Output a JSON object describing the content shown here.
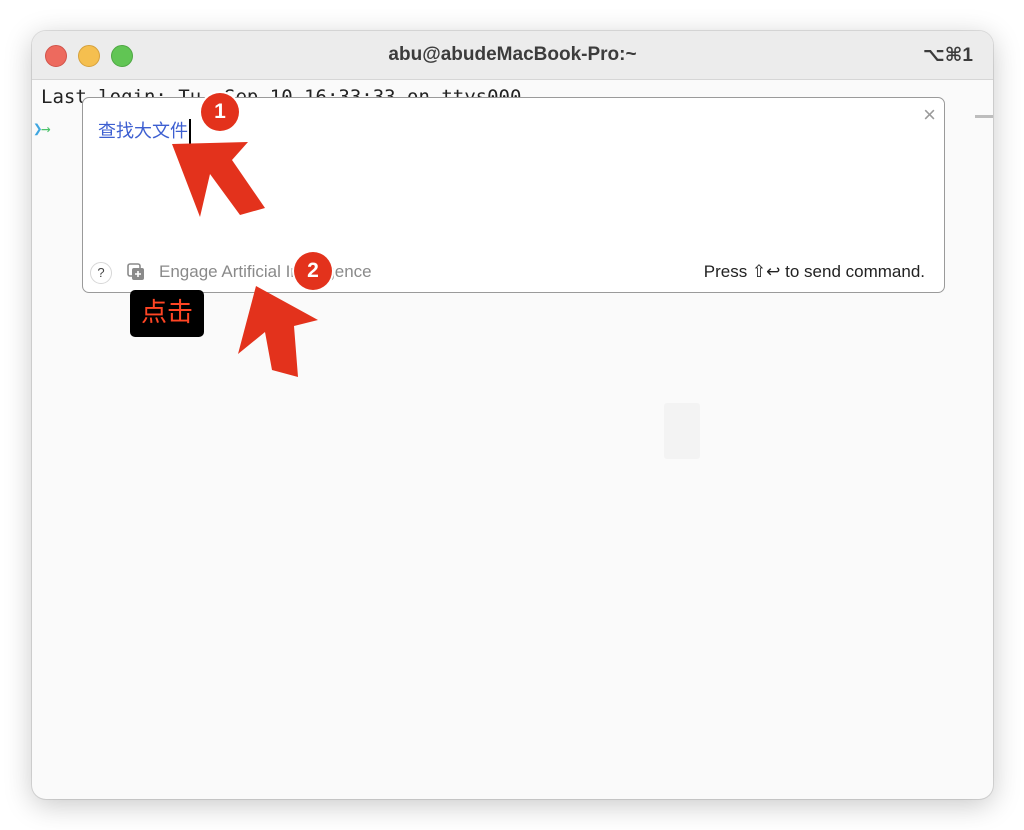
{
  "window": {
    "title": "abu@abudeMacBook-Pro:~",
    "shortcut": "⌥⌘1"
  },
  "terminal": {
    "last_login": "Last login: Tu  Sep 10 16:33:33 on ttys000",
    "prompt_glyph": "❯",
    "prompt_arrow": "→"
  },
  "ai_panel": {
    "query": "查找大文件",
    "help_label": "?",
    "engage_label": "Engage Artificial Intelligence",
    "send_hint": "Press ⇧↩ to send command.",
    "close_glyph": "×"
  },
  "annotations": {
    "step1": "1",
    "step2": "2",
    "click_tag": "点击",
    "accent_color": "#e3321c"
  }
}
